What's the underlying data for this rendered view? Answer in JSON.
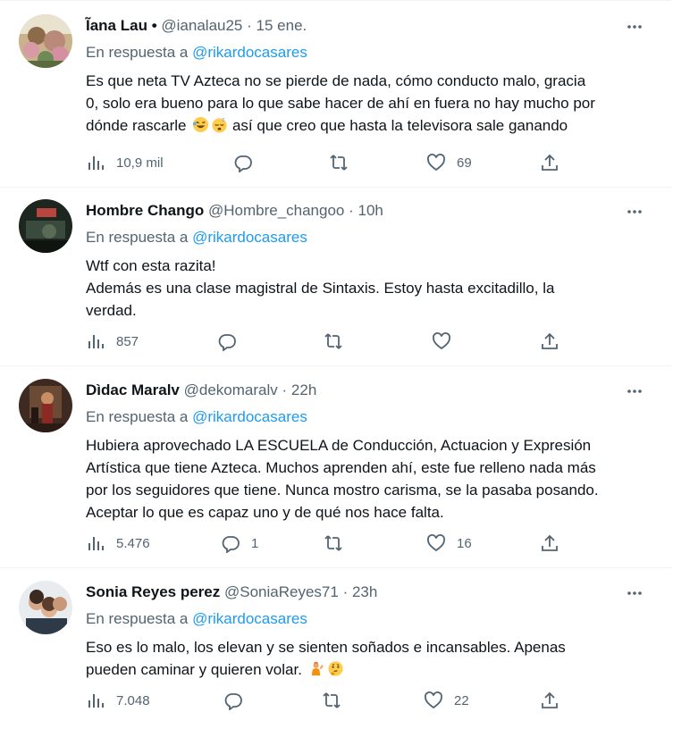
{
  "reply_prefix": "En respuesta a ",
  "colors": {
    "link": "#1d9bf0",
    "secondary": "#536471",
    "text": "#0f1419"
  },
  "tweets": [
    {
      "name": "Ĩana Lau",
      "name_suffix": "•",
      "handle": "@ianalau25",
      "dot": "·",
      "time": "15 ene.",
      "reply_to": "@rikardocasares",
      "lines": [
        "Es que neta TV Azteca no se pierde de nada, cómo conducto malo, gracia",
        "0, solo era bueno para lo que sabe hacer de ahí en fuera no hay mucho por",
        "dónde rascarle",
        "así que creo que hasta la televisora sale ganando"
      ],
      "emojis": [
        "rolling-laughing-emoji",
        "sleeping-emoji"
      ],
      "views": "10,9 mil",
      "replies": "",
      "retweets": "",
      "likes": "69"
    },
    {
      "name": "Hombre Chango",
      "handle": "@Hombre_changoo",
      "dot": "·",
      "time": "10h",
      "reply_to": "@rikardocasares",
      "lines": [
        "Wtf con esta razita!",
        "Además es una clase magistral de Sintaxis. Estoy hasta excitadillo, la",
        "verdad."
      ],
      "views": "857",
      "replies": "",
      "retweets": "",
      "likes": ""
    },
    {
      "name": "Dìdac Maralv",
      "handle": "@dekomaralv",
      "dot": "·",
      "time": "22h",
      "reply_to": "@rikardocasares",
      "lines": [
        "Hubiera aprovechado LA ESCUELA de Conducción, Actuacion y Expresión",
        "Artística que tiene Azteca. Muchos aprenden ahí, este fue relleno nada más",
        "por los seguidores que tiene. Nunca mostro carisma, se la pasaba posando.",
        "Aceptar lo que es capaz uno y de qué nos hace falta."
      ],
      "views": "5.476",
      "replies": "1",
      "retweets": "",
      "likes": "16"
    },
    {
      "name": "Sonia Reyes perez",
      "handle": "@SoniaReyes71",
      "dot": "·",
      "time": "23h",
      "reply_to": "@rikardocasares",
      "lines": [
        "Eso es lo malo, los elevan y se sienten soñados e incansables. Apenas",
        "pueden caminar y quieren volar."
      ],
      "emojis": [
        "person-climbing-emoji",
        "thinking-face-emoji"
      ],
      "views": "7.048",
      "replies": "",
      "retweets": "",
      "likes": "22"
    }
  ]
}
